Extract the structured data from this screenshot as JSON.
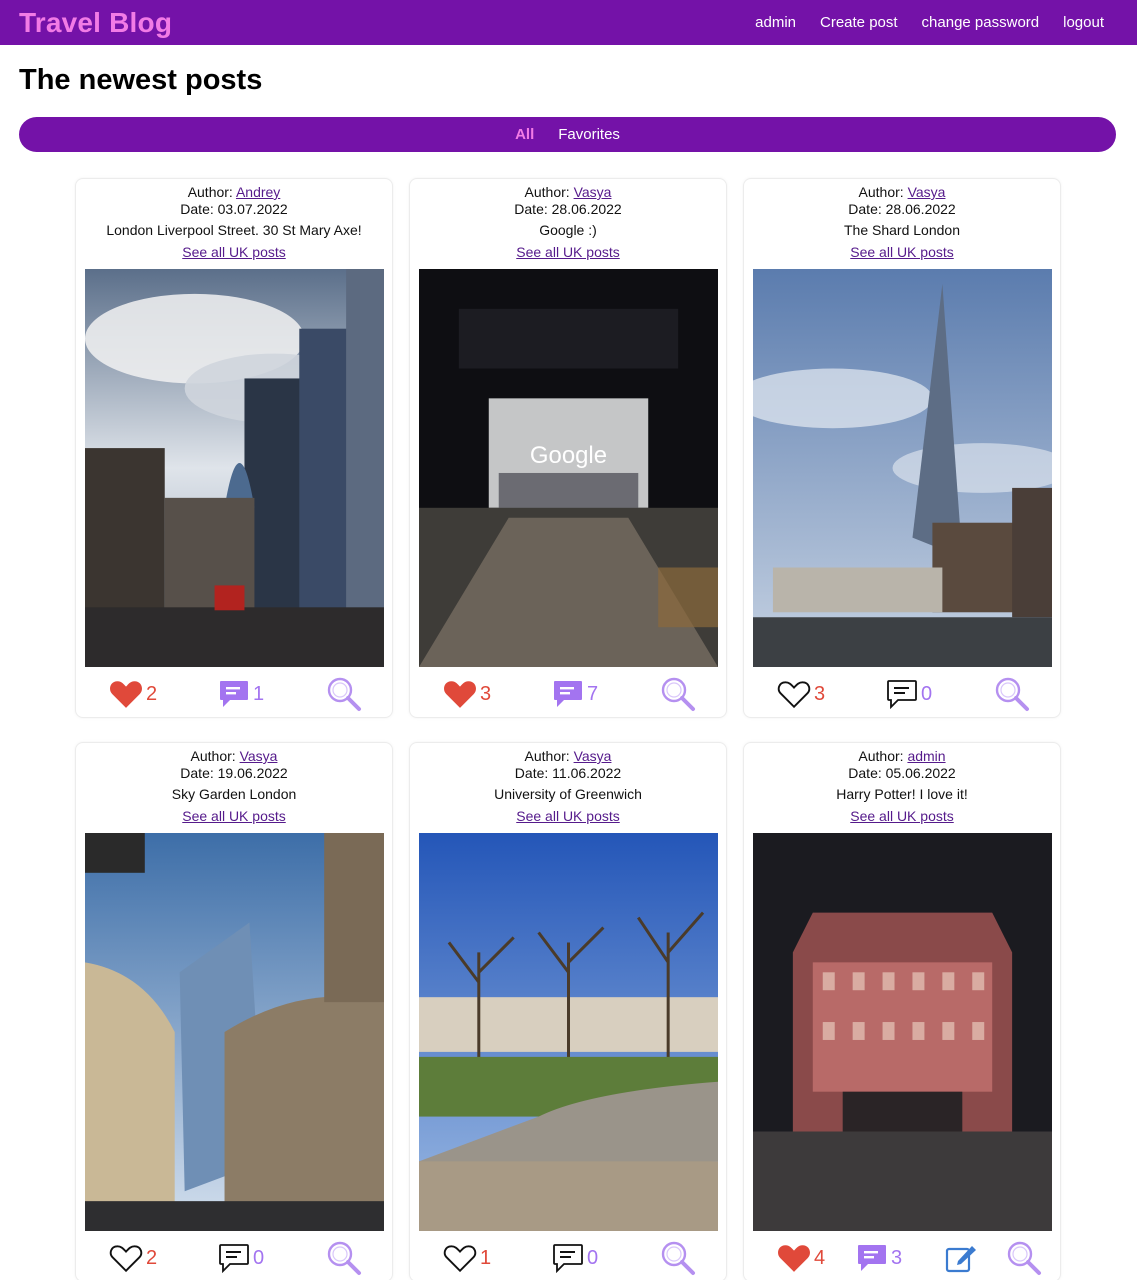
{
  "nav": {
    "brand": "Travel Blog",
    "links": [
      "admin",
      "Create post",
      "change password",
      "logout"
    ]
  },
  "page": {
    "title": "The newest posts"
  },
  "filters": {
    "tabs": [
      "All",
      "Favorites"
    ],
    "active": "All"
  },
  "labels": {
    "author_prefix": "Author: ",
    "date_prefix": "Date: ",
    "see_all": "See all UK posts"
  },
  "colors": {
    "primary": "#7412a8",
    "accent": "#f27be6",
    "like_red": "#e0493a",
    "comment_purple": "#a374f0"
  },
  "posts": [
    {
      "author": "Andrey",
      "date": "03.07.2022",
      "caption": "London Liverpool Street. 30 St Mary Axe!",
      "likes": "2",
      "liked": true,
      "comments": "1",
      "has_comments": true,
      "editable": false,
      "photo": "city-street"
    },
    {
      "author": "Vasya",
      "date": "28.06.2022",
      "caption": "Google :)",
      "likes": "3",
      "liked": true,
      "comments": "7",
      "has_comments": true,
      "editable": false,
      "photo": "office-entrance-night"
    },
    {
      "author": "Vasya",
      "date": "28.06.2022",
      "caption": "The Shard London",
      "likes": "3",
      "liked": false,
      "comments": "0",
      "has_comments": false,
      "editable": false,
      "photo": "skyscraper-river"
    },
    {
      "author": "Vasya",
      "date": "19.06.2022",
      "caption": "Sky Garden London",
      "likes": "2",
      "liked": false,
      "comments": "0",
      "has_comments": false,
      "editable": false,
      "photo": "towers-blue-sky"
    },
    {
      "author": "Vasya",
      "date": "11.06.2022",
      "caption": "University of Greenwich",
      "likes": "1",
      "liked": false,
      "comments": "0",
      "has_comments": false,
      "editable": false,
      "photo": "park-trees"
    },
    {
      "author": "admin",
      "date": "05.06.2022",
      "caption": "Harry Potter! I love it!",
      "likes": "4",
      "liked": true,
      "comments": "3",
      "has_comments": true,
      "editable": true,
      "photo": "theatre-night"
    }
  ]
}
